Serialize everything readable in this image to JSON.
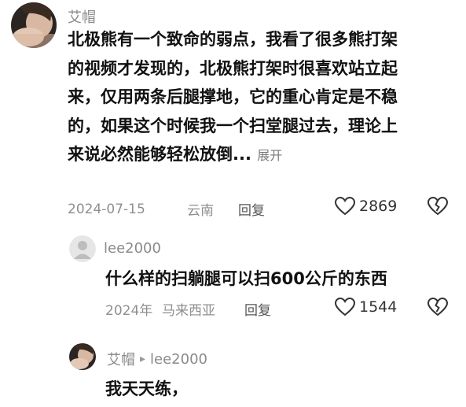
{
  "comment": {
    "username": "艾帽",
    "text_lines": [
      "北极熊有一个致命的弱点，我看了很多熊打架",
      "的视频才发现的，北极熊打架时很喜欢站立起",
      "来，仅用两条后腿撑地，它的重心肯定是不稳",
      "的，如果这个时候我一个扫堂腿过去，理论上",
      "来说必然能够轻松放倒..."
    ],
    "expand_label": "展开",
    "date": "2024-07-15",
    "location": "云南",
    "reply_label": "回复",
    "like_count": "2869",
    "icons": {
      "like": "heart-outline-icon",
      "dislike": "broken-heart-outline-icon"
    }
  },
  "reply1": {
    "username": "lee2000",
    "text": "什么样的扫躺腿可以扫600公斤的东西",
    "date": "2024年",
    "location": "马来西亚",
    "reply_label": "回复",
    "like_count": "1544"
  },
  "reply2": {
    "username": "艾帽",
    "reply_arrow": "▸",
    "reply_to": "lee2000",
    "text": "我天天练，"
  },
  "colors": {
    "text": "#111111",
    "muted": "#8a8a8a",
    "background": "#ffffff"
  }
}
